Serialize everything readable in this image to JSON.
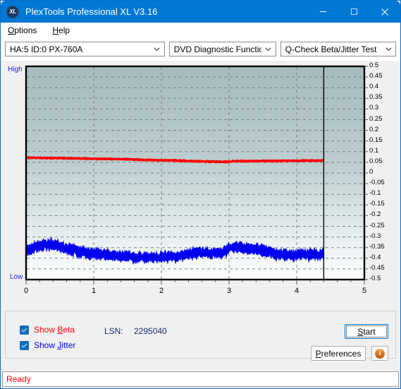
{
  "window": {
    "title": "PlexTools Professional XL V3.16",
    "app_icon": "XL",
    "minimize_icon": "minimize-icon",
    "maximize_icon": "maximize-icon",
    "close_icon": "close-icon"
  },
  "menubar": {
    "items": [
      {
        "label": "Options",
        "mnemonic": "O"
      },
      {
        "label": "Help",
        "mnemonic": "H"
      }
    ]
  },
  "toolbar": {
    "drive_select": "HA:5 ID:0  PX-760A",
    "function_select": "DVD Diagnostic Functions",
    "test_select": "Q-Check Beta/Jitter Test"
  },
  "chart_labels": {
    "high": "High",
    "low": "Low"
  },
  "controls": {
    "show_beta": "Show Beta",
    "show_beta_mnemonic": "B",
    "show_jitter": "Show Jitter",
    "show_jitter_mnemonic": "J",
    "lsn_label": "LSN:",
    "lsn_value": "2295040",
    "start_button": "Start",
    "start_mnemonic": "S",
    "preferences_button": "Preferences",
    "preferences_mnemonic": "P",
    "info_button": "i"
  },
  "statusbar": {
    "text": "Ready"
  },
  "colors": {
    "titlebar": "#0078d4",
    "beta_series": "#ff0000",
    "jitter_series": "#0000ee",
    "accent": "#0f6cbd",
    "status_text": "#ff0000"
  },
  "chart_data": {
    "type": "line",
    "title": "Q-Check Beta/Jitter Test",
    "xlabel": "",
    "ylabel": "",
    "xlim": [
      0,
      5
    ],
    "ylim": [
      -0.5,
      0.5
    ],
    "x_ticks": [
      0,
      1,
      2,
      3,
      4,
      5
    ],
    "y_ticks": [
      0.5,
      0.45,
      0.4,
      0.35,
      0.3,
      0.25,
      0.2,
      0.15,
      0.1,
      0.05,
      0,
      -0.05,
      -0.1,
      -0.15,
      -0.2,
      -0.25,
      -0.3,
      -0.35,
      -0.4,
      -0.45,
      -0.5
    ],
    "grid": true,
    "legend_position": "bottom-left",
    "data_end_x": 4.4,
    "axis_end_marker": "vertical black line at x = 4.4",
    "series": [
      {
        "name": "Show Beta",
        "color": "#ff0000",
        "x": [
          0.0,
          0.2,
          0.4,
          0.6,
          0.8,
          1.0,
          1.2,
          1.4,
          1.6,
          1.8,
          2.0,
          2.2,
          2.4,
          2.6,
          2.8,
          3.0,
          3.05,
          3.2,
          3.4,
          3.6,
          3.8,
          4.0,
          4.2,
          4.4
        ],
        "values": [
          0.072,
          0.071,
          0.07,
          0.069,
          0.068,
          0.067,
          0.066,
          0.065,
          0.063,
          0.061,
          0.06,
          0.058,
          0.056,
          0.054,
          0.053,
          0.052,
          0.055,
          0.055,
          0.056,
          0.056,
          0.057,
          0.057,
          0.058,
          0.058
        ],
        "noise_amplitude": 0.004
      },
      {
        "name": "Show Jitter",
        "color": "#0000ee",
        "x": [
          0.0,
          0.15,
          0.3,
          0.45,
          0.6,
          0.8,
          1.0,
          1.2,
          1.4,
          1.6,
          1.8,
          2.0,
          2.2,
          2.4,
          2.55,
          2.7,
          2.9,
          3.0,
          3.1,
          3.3,
          3.5,
          3.7,
          3.9,
          4.1,
          4.3,
          4.4
        ],
        "values": [
          -0.37,
          -0.345,
          -0.335,
          -0.34,
          -0.355,
          -0.37,
          -0.378,
          -0.385,
          -0.39,
          -0.395,
          -0.398,
          -0.396,
          -0.394,
          -0.38,
          -0.372,
          -0.374,
          -0.376,
          -0.352,
          -0.348,
          -0.355,
          -0.362,
          -0.38,
          -0.385,
          -0.383,
          -0.382,
          -0.382
        ],
        "noise_amplitude": 0.022
      }
    ]
  }
}
